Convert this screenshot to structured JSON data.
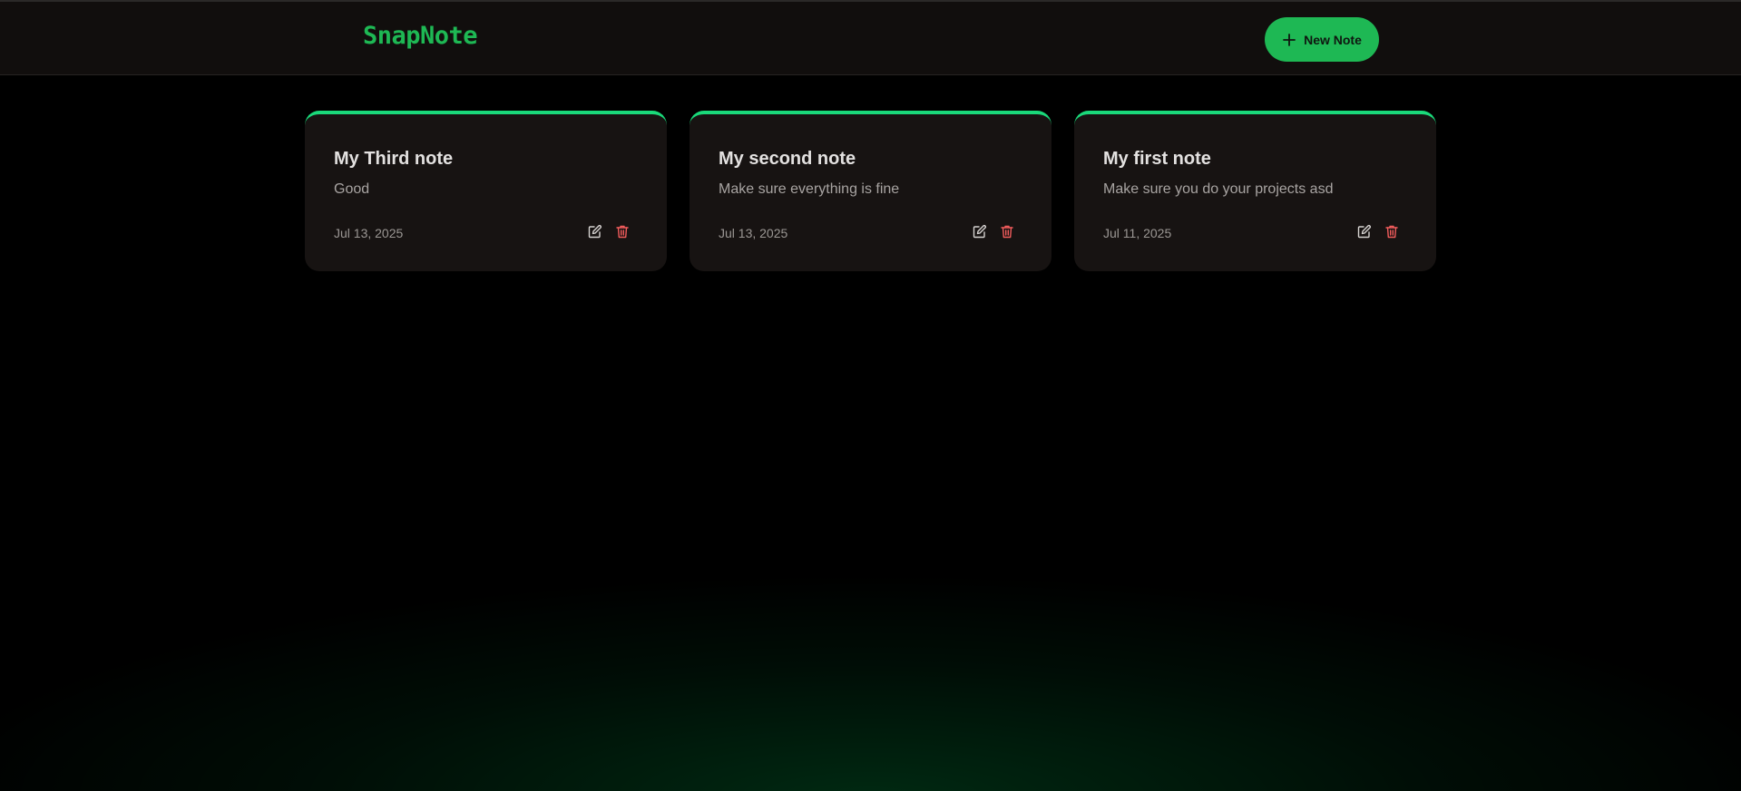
{
  "header": {
    "brand": "SnapNote",
    "new_note_label": "New Note"
  },
  "icons": {
    "new_note": "plus-icon",
    "edit": "edit-icon",
    "delete": "trash-icon"
  },
  "colors": {
    "accent": "#1eb854",
    "card_top_border": "#1ad97a",
    "delete_icon": "#f25c5c",
    "background": "#000000"
  },
  "notes": [
    {
      "title": "My Third note",
      "content": "Good",
      "date": "Jul 13, 2025"
    },
    {
      "title": "My second note",
      "content": "Make sure everything is fine",
      "date": "Jul 13, 2025"
    },
    {
      "title": "My first note",
      "content": "Make sure you do your projects asd",
      "date": "Jul 11, 2025"
    }
  ]
}
